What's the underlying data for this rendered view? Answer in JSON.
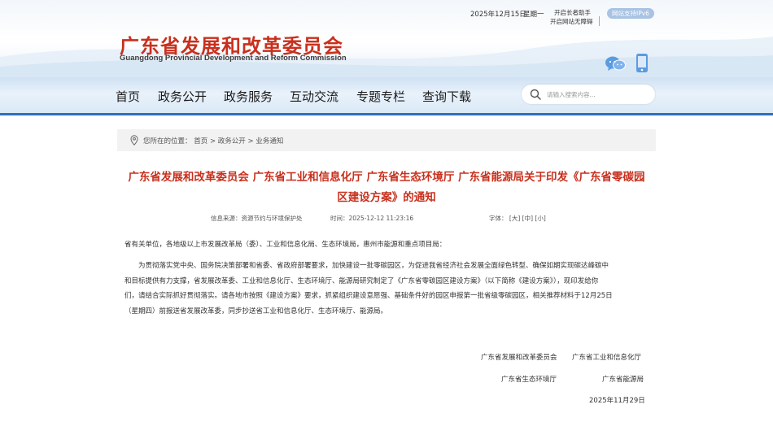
{
  "header": {
    "logo_cn": "广东省发展和改革委员会",
    "logo_en": "Guangdong Provincial Development and Reform Commission",
    "date": "2025年12月15日",
    "weekday": "星期一",
    "elder_mode": "开启长者助手",
    "accessibility": "开启网站无障碍",
    "ipv6": "网站支持IPv6"
  },
  "nav": {
    "items": [
      "首页",
      "政务公开",
      "政务服务",
      "互动交流",
      "专题专栏",
      "查询下载"
    ],
    "search_placeholder": "请输入搜索内容..."
  },
  "breadcrumb": {
    "prefix": "您所在的位置：",
    "items": [
      "首页",
      "政务公开",
      "业务通知"
    ],
    "separator": ">"
  },
  "article": {
    "title_line1": "广东省发展和改革委员会 广东省工业和信息化厅 广东省生态环境厅 广东省能源局关于印发《广东省零碳园",
    "title_line2": "区建设方案》的通知",
    "source": "信息来源：资源节约与环境保护处",
    "time": "时间：2025-12-12 11:23:16",
    "font_label": "字体：",
    "font_large": "[大]",
    "font_medium": "[中]",
    "font_small": "[小]",
    "salutation": "省有关单位，各地级以上市发展改革局（委）、工业和信息化局、生态环境局，惠州市能源和重点项目局：",
    "body_lines": [
      "　　为贯彻落实党中央、国务院决策部署和省委、省政府部署要求，加快建设一批零碳园区，为促进我省经济社会发展全面绿色转型、确保如期实现碳达峰碳中",
      "和目标提供有力支撑，省发展改革委、工业和信息化厅、生态环境厅、能源局研究制定了《广东省零碳园区建设方案》（以下简称《建设方案》），现印发给你",
      "们，请结合实际抓好贯彻落实。请各地市按照《建设方案》要求，抓紧组织建设意愿强、基础条件好的园区申报第一批省级零碳园区，相关推荐材料于12月25日",
      "（星期四）前报送省发展改革委，同步抄送省工业和信息化厅、生态环境厅、能源局。"
    ],
    "signatures": {
      "org1": "广东省发展和改革委员会",
      "org2": "广东省工业和信息化厅",
      "org3": "广东省生态环境厅",
      "org4": "广东省能源局",
      "date": "2025年11月29日"
    }
  },
  "colors": {
    "title_red": "#c8301d",
    "nav_accent": "#2f6fb7",
    "ipv6_badge": "#a8c3e3"
  }
}
